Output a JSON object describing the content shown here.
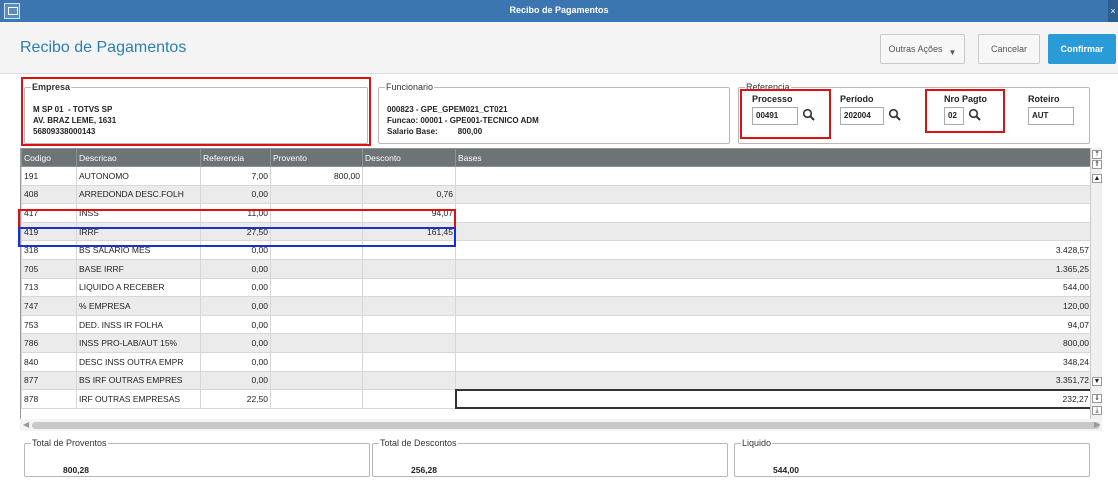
{
  "window": {
    "title": "Recibo de Pagamentos"
  },
  "header": {
    "title": "Recibo de Pagamentos",
    "more_label": "Outras Ações",
    "cancel_label": "Cancelar",
    "confirm_label": "Confirmar"
  },
  "empresa": {
    "legend": "Empresa",
    "lines": [
      "M SP 01  - TOTVS SP",
      "AV. BRAZ LEME, 1631",
      "56809338000143"
    ]
  },
  "funcionario": {
    "legend": "Funcionario",
    "lines": [
      "000823 - GPE_GPEM021_CT021",
      "Funcao: 00001 - GPE001-TECNICO ADM",
      "Salario Base:         800,00"
    ]
  },
  "referencia": {
    "legend": "Referencia",
    "processo": {
      "label": "Processo",
      "value": "00491"
    },
    "periodo": {
      "label": "Período",
      "value": "202004"
    },
    "nro_pagto": {
      "label": "Nro Pagto",
      "value": "02"
    },
    "roteiro": {
      "label": "Roteiro",
      "value": "AUT"
    }
  },
  "grid": {
    "columns": [
      "Codigo",
      "Descricao",
      "Referencia",
      "Provento",
      "Desconto",
      "Bases"
    ],
    "rows": [
      [
        "191",
        "AUTONOMO",
        "7,00",
        "800,00",
        "",
        ""
      ],
      [
        "408",
        "ARREDONDA DESC.FOLH",
        "0,00",
        "",
        "0,76",
        ""
      ],
      [
        "417",
        "INSS",
        "11,00",
        "",
        "94,07",
        ""
      ],
      [
        "419",
        "IRRF",
        "27,50",
        "",
        "161,45",
        ""
      ],
      [
        "318",
        "BS SALARIO MES",
        "0,00",
        "",
        "",
        "3.428,57"
      ],
      [
        "705",
        "BASE IRRF",
        "0,00",
        "",
        "",
        "1.365,25"
      ],
      [
        "713",
        "LIQUIDO A RECEBER",
        "0,00",
        "",
        "",
        "544,00"
      ],
      [
        "747",
        "% EMPRESA",
        "0,00",
        "",
        "",
        "120,00"
      ],
      [
        "753",
        "DED. INSS IR FOLHA",
        "0,00",
        "",
        "",
        "94,07"
      ],
      [
        "786",
        "INSS PRO-LAB/AUT 15%",
        "0,00",
        "",
        "",
        "800,00"
      ],
      [
        "840",
        "DESC INSS OUTRA EMPR",
        "0,00",
        "",
        "",
        "348,24"
      ],
      [
        "877",
        "BS IRF OUTRAS EMPRES",
        "0,00",
        "",
        "",
        "3.351,72"
      ],
      [
        "878",
        "IRF OUTRAS EMPRESAS",
        "22,50",
        "",
        "",
        "232,27"
      ]
    ]
  },
  "totals": {
    "proventos": {
      "legend": "Total de Proventos",
      "value": "800,28"
    },
    "descontos": {
      "legend": "Total de Descontos",
      "value": "256,28"
    },
    "liquido": {
      "legend": "Liquido",
      "value": "544,00"
    }
  },
  "colors": {
    "titlebar": "#3c76b0",
    "accent": "#2c7fb0",
    "confirm": "#2a9bd6",
    "grid_header": "#6c7476",
    "highlight_red": "#e01010",
    "highlight_blue": "#1a2fd0"
  },
  "icons": {
    "lookup": "search-icon",
    "window": "window-icon",
    "dropdown": "chevron-down-icon"
  }
}
